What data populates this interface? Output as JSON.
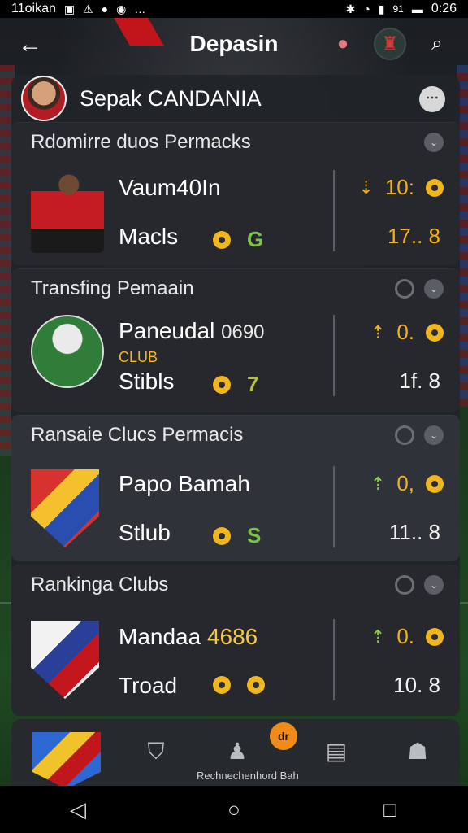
{
  "status": {
    "left_text": "11oikan",
    "time": "0:26",
    "battery_text": "91"
  },
  "appbar": {
    "title": "Depasin"
  },
  "profile": {
    "name": "Sepak CANDANIA"
  },
  "sections": [
    {
      "title": "Rdomirre duos Permacks",
      "row1_name": "Vaum40In",
      "row2_label": "Macls",
      "row2_value": "G",
      "right_top": "10:",
      "right_bottom": "17.. 8"
    },
    {
      "title": "Transfing Pemaain",
      "row1_name": "Paneudal",
      "row1_num": "0690",
      "club_tag": "CLUB",
      "row2_label": "Stibls",
      "row2_value": "7",
      "right_top": "0.",
      "right_bottom": "1f. 8"
    },
    {
      "title": "Ransaie Clucs Permacis",
      "row1_name": "Papo Bamah",
      "row2_label": "Stlub",
      "row2_value": "S",
      "right_top": "0,",
      "right_bottom": "11.. 8"
    },
    {
      "title": "Rankinga Clubs",
      "row1_name": "Mandaa",
      "row1_num": "4686",
      "row2_label": "Troad",
      "row2_value": "",
      "right_top": "0.",
      "right_bottom": "10. 8"
    }
  ],
  "bottomnav": {
    "badge": "dr",
    "caption": "Rechnechenhord Bah"
  },
  "colors": {
    "accent_gold": "#f1b51e",
    "accent_green": "#7cc24a",
    "badge_orange": "#f08a18",
    "panel": "#26292e"
  }
}
